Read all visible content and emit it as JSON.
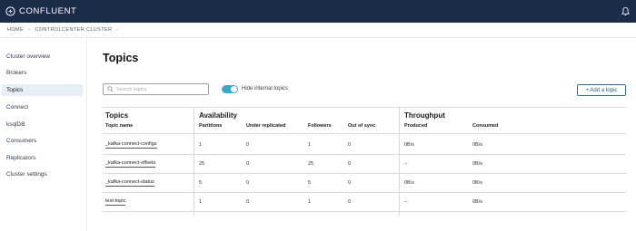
{
  "header": {
    "brand": "CONFLUENT",
    "logo_icon": "confluent-logo-icon",
    "bell_icon": "bell-icon",
    "bar_color": "#1c2b4a"
  },
  "breadcrumb": {
    "home": "HOME",
    "cluster": "CONTROLCENTER.CLUSTER"
  },
  "sidebar": {
    "items": [
      {
        "label": "Cluster overview",
        "active": false
      },
      {
        "label": "Brokers",
        "active": false
      },
      {
        "label": "Topics",
        "active": true
      },
      {
        "label": "Connect",
        "active": false
      },
      {
        "label": "ksqlDB",
        "active": false
      },
      {
        "label": "Consumers",
        "active": false
      },
      {
        "label": "Replicators",
        "active": false
      },
      {
        "label": "Cluster settings",
        "active": false
      }
    ]
  },
  "main": {
    "title": "Topics",
    "search": {
      "placeholder": "Search topics",
      "value": ""
    },
    "toggle": {
      "label": "Hide internal topics",
      "on": true
    },
    "add_button": "+ Add a topic"
  },
  "table": {
    "groups": {
      "topics": "Topics",
      "availability": "Availability",
      "throughput": "Throughput"
    },
    "columns": {
      "name": "Topic name",
      "partitions": "Partitions",
      "under_replicated": "Under replicated",
      "followers": "Followers",
      "out_of_sync": "Out of sync",
      "produced": "Produced",
      "consumed": "Consumed"
    },
    "rows": [
      {
        "name": "_kafka-connect-configs",
        "partitions": "1",
        "under_replicated": "0",
        "followers": "1",
        "out_of_sync": "0",
        "produced": "0B/s",
        "consumed": "0B/s"
      },
      {
        "name": "_kafka-connect-offsets",
        "partitions": "25",
        "under_replicated": "0",
        "followers": "25",
        "out_of_sync": "0",
        "produced": "--",
        "consumed": "0B/s"
      },
      {
        "name": "_kafka-connect-status",
        "partitions": "5",
        "under_replicated": "0",
        "followers": "5",
        "out_of_sync": "0",
        "produced": "0B/s",
        "consumed": "0B/s"
      },
      {
        "name": "test-topic",
        "partitions": "1",
        "under_replicated": "0",
        "followers": "1",
        "out_of_sync": "0",
        "produced": "--",
        "consumed": "0B/s"
      }
    ]
  },
  "colors": {
    "accent": "#3aa9c4",
    "button": "#1f5a82"
  }
}
